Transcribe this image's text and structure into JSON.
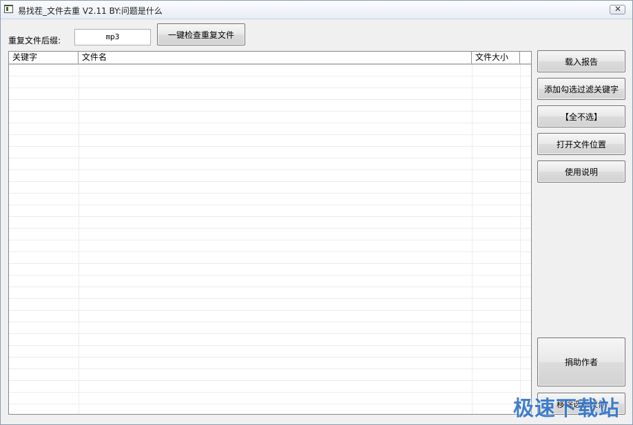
{
  "window": {
    "title": "易找茬_文件去重 V2.11   BY:问题是什么",
    "close_symbol": "✕"
  },
  "toolbar": {
    "suffix_label": "重复文件后缀:",
    "suffix_value": "mp3",
    "check_button": "一键检查重复文件"
  },
  "list": {
    "columns": [
      "关键字",
      "文件名",
      "文件大小",
      ""
    ],
    "rows": []
  },
  "side_buttons": {
    "load_report": "载入报告",
    "add_filter": "添加勾选过滤关键字",
    "deselect_all": "【全不选】",
    "open_location": "打开文件位置",
    "instructions": "使用说明",
    "donate": "捐助作者",
    "remove_selected": "移除选中文件"
  },
  "watermark": {
    "text": "极速下载站"
  },
  "icons": {
    "app": "app-window-icon",
    "close": "close-icon"
  }
}
